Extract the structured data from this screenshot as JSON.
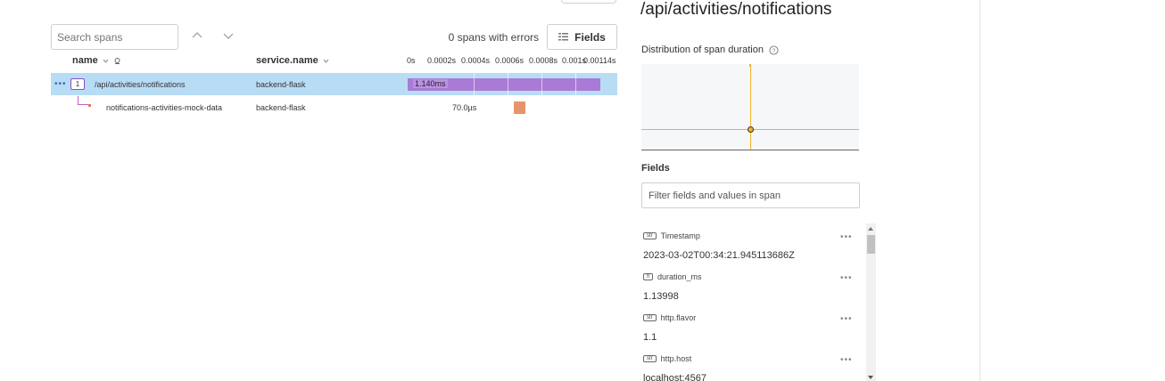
{
  "toolbar": {
    "search_placeholder": "Search spans",
    "errors_text": "0 spans with errors",
    "fields_button": "Fields"
  },
  "columns": {
    "name": "name",
    "service": "service.name"
  },
  "timeline_ticks": [
    "0s",
    "0.0002s",
    "0.0004s",
    "0.0006s",
    "0.0008s",
    "0.001s",
    "0.00114s"
  ],
  "spans": [
    {
      "count": "1",
      "name": "/api/activities/notifications",
      "service": "backend-flask",
      "duration_label": "1.140ms",
      "selected": true
    },
    {
      "name": "notifications-activities-mock-data",
      "service": "backend-flask",
      "duration_label": "70.0µs",
      "selected": false
    }
  ],
  "detail": {
    "title": "/api/activities/notifications",
    "distribution_label": "Distribution of span duration",
    "fields_label": "Fields",
    "filter_placeholder": "Filter fields and values in span",
    "fields": [
      {
        "type": "str",
        "key": "Timestamp",
        "value": "2023-03-02T00:34:21.945113686Z"
      },
      {
        "type": "ﬂ",
        "key": "duration_ms",
        "value": "1.13998"
      },
      {
        "type": "str",
        "key": "http.flavor",
        "value": "1.1"
      },
      {
        "type": "str",
        "key": "http.host",
        "value": "localhost:4567"
      }
    ]
  },
  "colors": {
    "selected_row": "#b9dcf5",
    "main_bar": "#a97ad6",
    "child_bar": "#e8946b",
    "heatmap_crosshair": "#f0b429"
  },
  "icons": [
    "chevron-up-icon",
    "chevron-down-icon",
    "fields-grid-icon",
    "sort-chevron-icon",
    "pin-icon",
    "help-icon",
    "more-dots-icon"
  ]
}
